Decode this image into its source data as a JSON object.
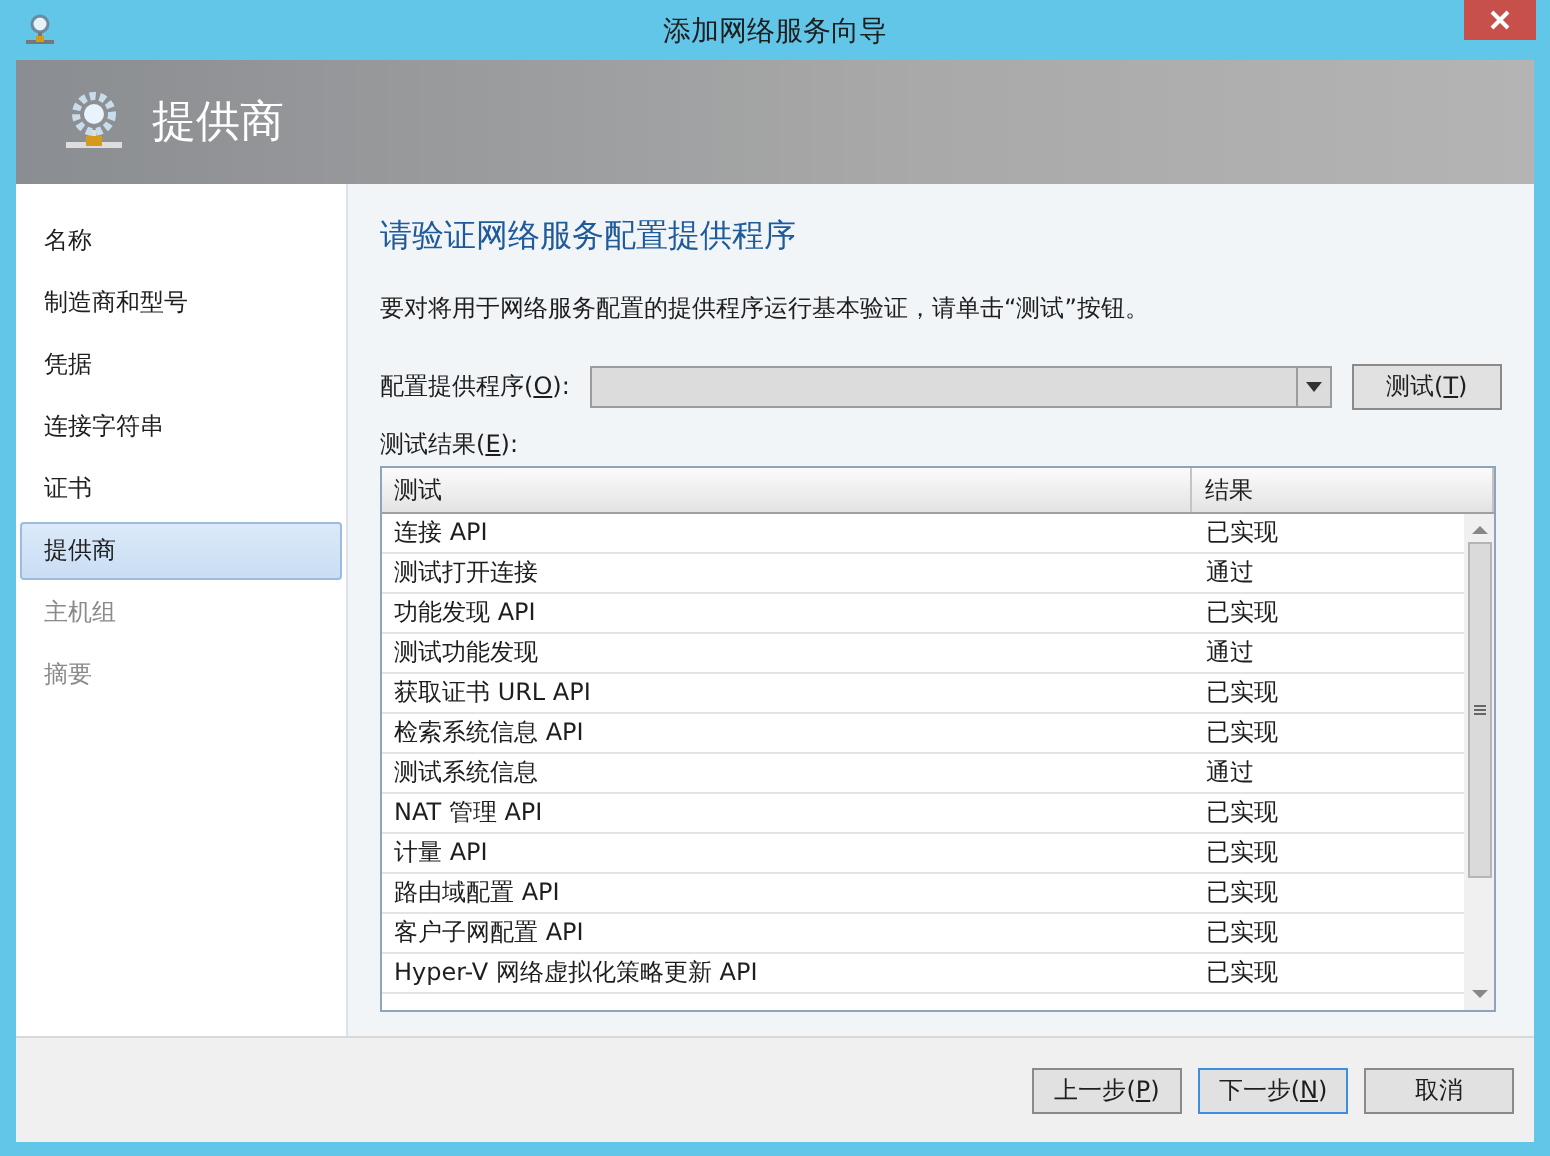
{
  "window": {
    "title": "添加网络服务向导"
  },
  "header": {
    "title": "提供商"
  },
  "sidebar": {
    "items": [
      {
        "label": "名称",
        "selected": false,
        "disabled": false
      },
      {
        "label": "制造商和型号",
        "selected": false,
        "disabled": false
      },
      {
        "label": "凭据",
        "selected": false,
        "disabled": false
      },
      {
        "label": "连接字符串",
        "selected": false,
        "disabled": false
      },
      {
        "label": "证书",
        "selected": false,
        "disabled": false
      },
      {
        "label": "提供商",
        "selected": true,
        "disabled": false
      },
      {
        "label": "主机组",
        "selected": false,
        "disabled": true
      },
      {
        "label": "摘要",
        "selected": false,
        "disabled": true
      }
    ]
  },
  "content": {
    "heading": "请验证网络服务配置提供程序",
    "description": "要对将用于网络服务配置的提供程序运行基本验证，请单击“测试”按钮。",
    "provider_field": {
      "label": {
        "before": "配置提供程序(",
        "key": "O",
        "after": "):"
      }
    },
    "test_button": {
      "before": "测试(",
      "key": "T",
      "after": ")"
    },
    "results_label": {
      "before": "测试结果(",
      "key": "E",
      "after": "):"
    },
    "table": {
      "columns": [
        "测试",
        "结果"
      ],
      "rows": [
        [
          "连接 API",
          "已实现"
        ],
        [
          "测试打开连接",
          "通过"
        ],
        [
          "功能发现 API",
          "已实现"
        ],
        [
          "测试功能发现",
          "通过"
        ],
        [
          "获取证书 URL API",
          "已实现"
        ],
        [
          "检索系统信息 API",
          "已实现"
        ],
        [
          "测试系统信息",
          "通过"
        ],
        [
          "NAT 管理 API",
          "已实现"
        ],
        [
          "计量 API",
          "已实现"
        ],
        [
          "路由域配置 API",
          "已实现"
        ],
        [
          "客户子网配置 API",
          "已实现"
        ],
        [
          "Hyper-V 网络虚拟化策略更新 API",
          "已实现"
        ]
      ]
    }
  },
  "buttons": [
    {
      "before": "上一步(",
      "key": "P",
      "after": ")",
      "focused": false
    },
    {
      "before": "下一步(",
      "key": "N",
      "after": ")",
      "focused": true
    },
    {
      "before": "取消",
      "focused": false
    }
  ]
}
